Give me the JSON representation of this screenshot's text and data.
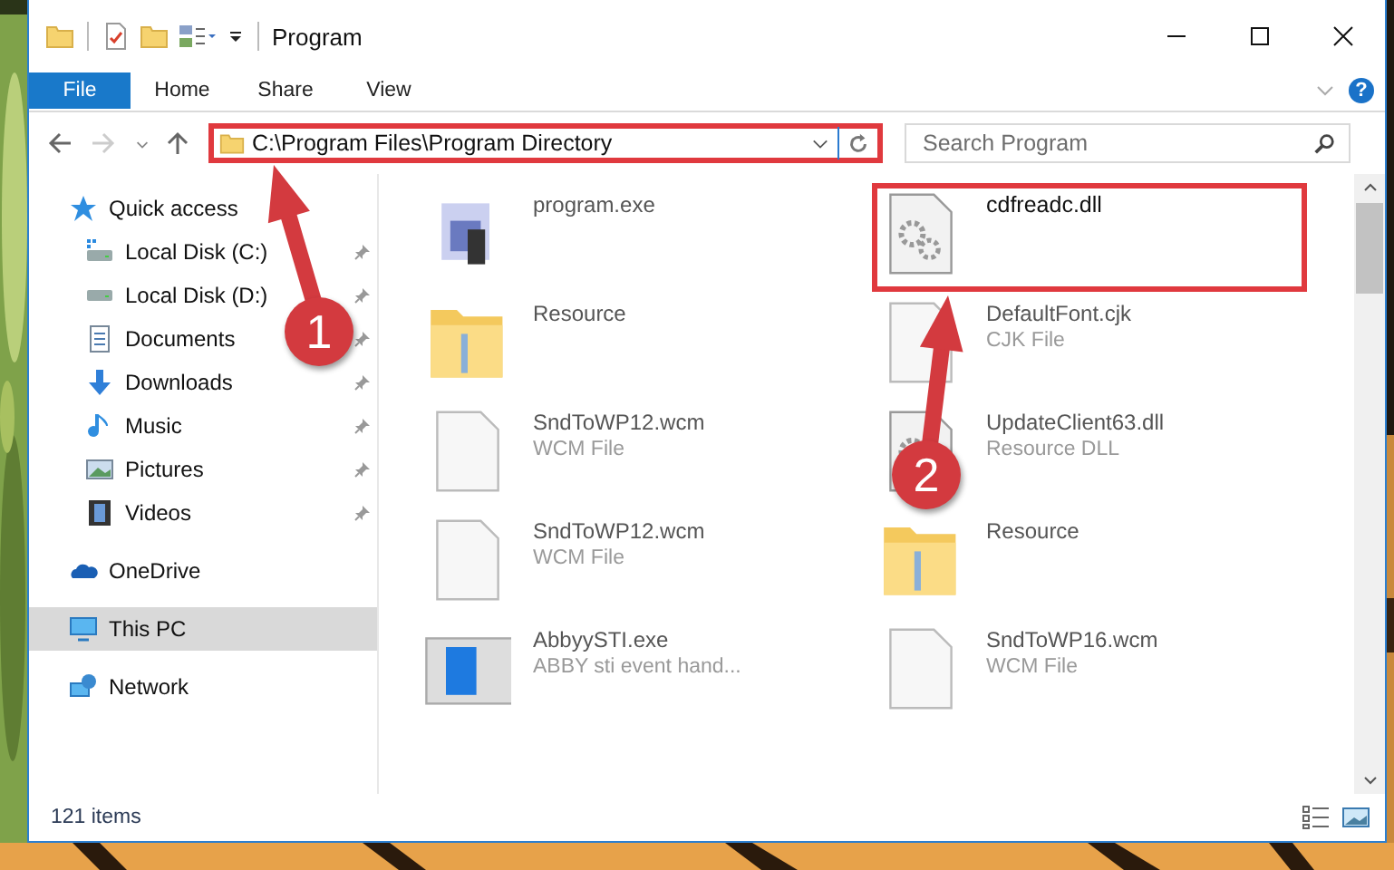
{
  "window": {
    "title": "Program"
  },
  "ribbon": {
    "tabs": [
      {
        "label": "File",
        "selected": true
      },
      {
        "label": "Home",
        "selected": false
      },
      {
        "label": "Share",
        "selected": false
      },
      {
        "label": "View",
        "selected": false
      }
    ],
    "help": "?"
  },
  "address": {
    "path": "C:\\Program Files\\Program Directory",
    "highlighted": true
  },
  "search": {
    "placeholder": "Search Program"
  },
  "sidebar": {
    "items": [
      {
        "label": "Quick access",
        "kind": "star",
        "selected": false,
        "children": [
          {
            "label": "Local Disk (C:)",
            "kind": "disk-c",
            "pinned": true
          },
          {
            "label": "Local Disk (D:)",
            "kind": "disk",
            "pinned": true
          },
          {
            "label": "Documents",
            "kind": "documents",
            "pinned": true
          },
          {
            "label": "Downloads",
            "kind": "downloads",
            "pinned": true
          },
          {
            "label": "Music",
            "kind": "music",
            "pinned": true
          },
          {
            "label": "Pictures",
            "kind": "pictures",
            "pinned": true
          },
          {
            "label": "Videos",
            "kind": "videos",
            "pinned": true
          }
        ]
      },
      {
        "label": "OneDrive",
        "kind": "cloud",
        "selected": false
      },
      {
        "label": "This PC",
        "kind": "pc",
        "selected": true
      },
      {
        "label": "Network",
        "kind": "network",
        "selected": false
      }
    ]
  },
  "files": [
    {
      "name": "program.exe",
      "kind": "program",
      "highlighted": false
    },
    {
      "name": "cdfreadc.dll",
      "kind": "library",
      "highlighted": true
    },
    {
      "name": "Resource",
      "kind": "folder",
      "highlighted": false
    },
    {
      "name": "DefaultFont.cjk",
      "type": "CJK File",
      "kind": "document",
      "highlighted": false
    },
    {
      "name": "SndToWP12.wcm",
      "type": "WCM File",
      "kind": "document",
      "highlighted": false
    },
    {
      "name": "UpdateClient63.dll",
      "type": "Resource DLL",
      "kind": "library",
      "highlighted": false
    },
    {
      "name": "SndToWP12.wcm",
      "type": "WCM File",
      "kind": "document",
      "highlighted": false
    },
    {
      "name": "Resource",
      "kind": "folder",
      "highlighted": false
    },
    {
      "name": "AbbyySTI.exe",
      "type": "ABBY sti event hand...",
      "kind": "application",
      "highlighted": false
    },
    {
      "name": "SndToWP16.wcm",
      "type": "WCM File",
      "kind": "document",
      "highlighted": false
    }
  ],
  "status_bar": {
    "count": "121 items"
  },
  "callouts": [
    {
      "number": "1"
    },
    {
      "number": "2"
    }
  ]
}
